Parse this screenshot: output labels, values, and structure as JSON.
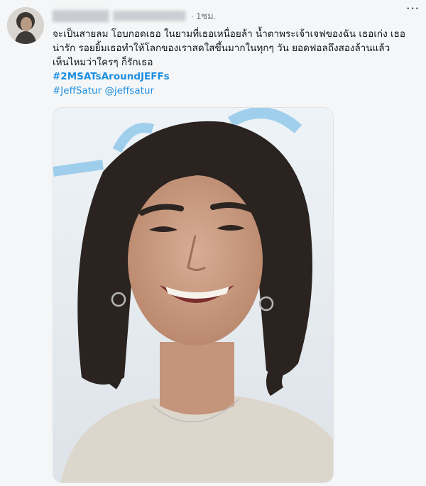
{
  "tweet": {
    "time": "1ชม.",
    "dot": "·",
    "more_label": "···",
    "lines": [
      "จะเป็นสายลม โอบกอดเธอ ในยามที่เธอเหนื่อยล้า น้ำตาพระเจ้าเจฟของฉัน เธอเก่ง เธอ",
      "น่ารัก รอยยิ้มเธอทำให้โลกของเราสดใสขึ้นมากในทุกๆ วัน ยอดฟอลถึงสองล้านแล้ว",
      "เห็นไหมว่าใครๆ ก็รักเธอ"
    ],
    "hashtag_main": "#2MSATsAroundJEFFs",
    "hashtag_jeff": "#JeffSatur",
    "mention": "@jeffsatur"
  },
  "colors": {
    "link": "#1d8fe0",
    "text": "#0f1419",
    "muted": "#6f777f"
  }
}
